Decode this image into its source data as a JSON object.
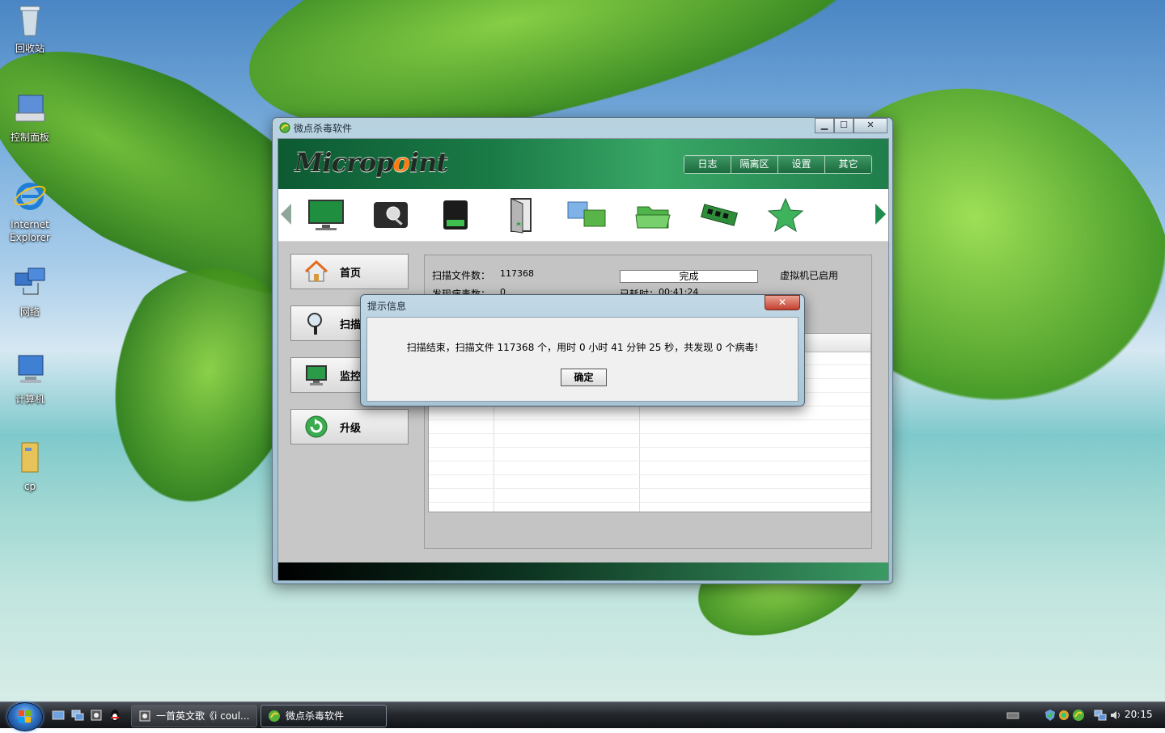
{
  "desktop": {
    "icons": [
      {
        "label": "回收站"
      },
      {
        "label": "控制面板"
      },
      {
        "label": "Internet Explorer"
      },
      {
        "label": "网络"
      },
      {
        "label": "计算机"
      },
      {
        "label": "cp"
      }
    ]
  },
  "window": {
    "title": "微点杀毒软件",
    "controls": {
      "minimize": "▁",
      "maximize": "☐",
      "close": "✕"
    },
    "logo": {
      "part1": "Microp",
      "dot": "o",
      "part2": "int"
    },
    "topnav": [
      "日志",
      "隔离区",
      "设置",
      "其它"
    ],
    "toolbar": {
      "icons": [
        "monitor-icon",
        "disk-scan-icon",
        "usb-drive-icon",
        "door-exit-icon",
        "network-share-icon",
        "folder-open-icon",
        "memory-icon",
        "star-icon"
      ]
    },
    "side_buttons": [
      {
        "label": "首页",
        "icon": "home-icon"
      },
      {
        "label": "扫描",
        "icon": "magnifier-icon"
      },
      {
        "label": "监控",
        "icon": "monitor-icon"
      },
      {
        "label": "升级",
        "icon": "update-icon"
      }
    ],
    "scan": {
      "files_label": "扫描文件数：",
      "files_value": "117368",
      "virus_label": "发现病毒数：",
      "virus_value": "0",
      "progress_text": "完成",
      "elapsed_label": "已耗时：",
      "elapsed_value": "00:41:24",
      "vm_status": "虚拟机已启用"
    }
  },
  "dialog": {
    "title": "提示信息",
    "close": "✕",
    "message": "扫描结束，扫描文件 117368 个，用时 0 小时 41 分钟 25 秒，共发现 0 个病毒!",
    "ok_label": "确定"
  },
  "taskbar": {
    "items": [
      {
        "label": "一首英文歌《i coul..."
      },
      {
        "label": "微点杀毒软件"
      }
    ],
    "clock": "20:15"
  },
  "colors": {
    "brand_green": "#1a7a46",
    "accent_orange": "#ff7a12",
    "title_bar": "#b8d2e0"
  }
}
